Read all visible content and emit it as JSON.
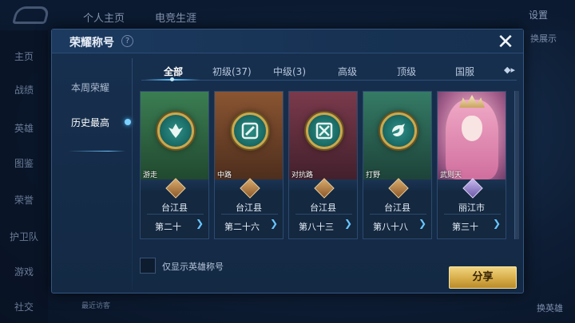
{
  "background": {
    "top_tabs": [
      "个人主页",
      "电竞生涯"
    ],
    "settings_label": "设置",
    "sidebar_items": [
      "主页",
      "战绩",
      "英雄",
      "图鉴",
      "荣誉",
      "护卫队",
      "游戏",
      "社交"
    ],
    "recent_visitors": "最近访客",
    "right_label_top": "换展示",
    "right_label_bottom": "换英雄"
  },
  "dialog": {
    "title": "荣耀称号",
    "help_icon": "?",
    "close_icon": "✕",
    "left_nav": [
      {
        "label": "本周荣耀",
        "active": false
      },
      {
        "label": "历史最高",
        "active": true
      }
    ],
    "tabs": [
      {
        "label": "全部",
        "active": true
      },
      {
        "label": "初级(37)",
        "active": false
      },
      {
        "label": "中级(3)",
        "active": false
      },
      {
        "label": "高级",
        "active": false
      },
      {
        "label": "顶级",
        "active": false
      },
      {
        "label": "国服",
        "active": false
      }
    ],
    "cards": [
      {
        "role": "游走",
        "region": "台江县",
        "rank": "第二十",
        "emblem": "support-emblem-icon",
        "badge": "bronze",
        "bg": "#2f6b45"
      },
      {
        "role": "中路",
        "region": "台江县",
        "rank": "第二十六",
        "emblem": "mid-lane-emblem-icon",
        "badge": "bronze",
        "bg": "#7a4a2a"
      },
      {
        "role": "对抗路",
        "region": "台江县",
        "rank": "第八十三",
        "emblem": "clash-lane-emblem-icon",
        "badge": "bronze",
        "bg": "#6a2f3e"
      },
      {
        "role": "打野",
        "region": "台江县",
        "rank": "第八十八",
        "emblem": "jungle-emblem-icon",
        "badge": "bronze",
        "bg": "#2d6b5a"
      },
      {
        "role": "武则天",
        "region": "丽江市",
        "rank": "第三十",
        "emblem": "hero-portrait",
        "badge": "silver",
        "bg": "#a45f8c"
      }
    ],
    "checkbox_label": "仅显示英雄称号",
    "share_label": "分享",
    "arrow_glyph": "❯",
    "more_icon": "◆▸"
  }
}
